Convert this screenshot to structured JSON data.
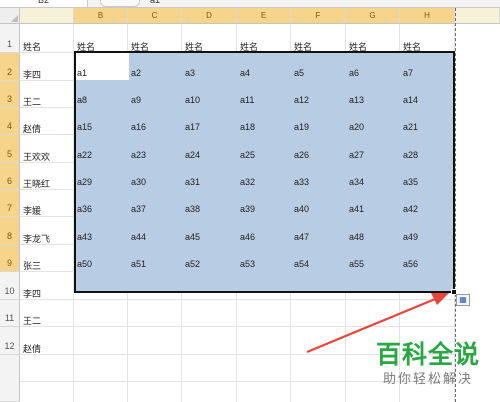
{
  "formula_bar": {
    "name_box": "B2",
    "value": "a1"
  },
  "columns": [
    "B",
    "C",
    "D",
    "E",
    "F",
    "G",
    "H"
  ],
  "rows": [
    "1",
    "2",
    "3",
    "4",
    "5",
    "6",
    "7",
    "8",
    "9",
    "10",
    "11",
    "12"
  ],
  "column_a": [
    "姓名",
    "李四",
    "王二",
    "赵倩",
    "王欢欢",
    "王晓红",
    "李媛",
    "李龙飞",
    "张三",
    "李四",
    "王二",
    "赵倩"
  ],
  "header_row": [
    "姓名",
    "姓名",
    "姓名",
    "姓名",
    "姓名",
    "姓名",
    "姓名"
  ],
  "grid": [
    [
      "a1",
      "a2",
      "a3",
      "a4",
      "a5",
      "a6",
      "a7"
    ],
    [
      "a8",
      "a9",
      "a10",
      "a11",
      "a12",
      "a13",
      "a14"
    ],
    [
      "a15",
      "a16",
      "a17",
      "a18",
      "a19",
      "a20",
      "a21"
    ],
    [
      "a22",
      "a23",
      "a24",
      "a25",
      "a26",
      "a27",
      "a28"
    ],
    [
      "a29",
      "a30",
      "a31",
      "a32",
      "a33",
      "a34",
      "a35"
    ],
    [
      "a36",
      "a37",
      "a38",
      "a39",
      "a40",
      "a41",
      "a42"
    ],
    [
      "a43",
      "a44",
      "a45",
      "a46",
      "a47",
      "a48",
      "a49"
    ],
    [
      "a50",
      "a51",
      "a52",
      "a53",
      "a54",
      "a55",
      "a56"
    ]
  ],
  "selection": {
    "range_start": "B2",
    "range_end": "H9"
  },
  "paste_options_icon": "paste-options-icon",
  "annotation_arrow_color": "#e8453c",
  "watermark": {
    "logo": "百科全说",
    "tagline": "助你轻松解决",
    "color": "#2aa645"
  }
}
